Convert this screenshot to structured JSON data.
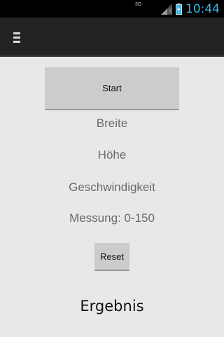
{
  "status_bar": {
    "network_type": "3G",
    "time": "10:44",
    "icons": [
      "signal-icon",
      "battery-charging-icon"
    ]
  },
  "action_bar": {
    "menu_icon": "menu-icon"
  },
  "main": {
    "start_label": "Start",
    "width_label": "Breite",
    "height_label": "Höhe",
    "speed_label": "Geschwindigkeit",
    "measurement_label": "Messung: 0-150",
    "reset_label": "Reset",
    "result_label": "Ergebnis"
  },
  "colors": {
    "status_bar_bg": "#000000",
    "clock": "#33b5e5",
    "action_bar_bg": "#222222",
    "screen_bg": "#e8e8e8",
    "button_bg": "#cccccc",
    "label_text": "#6b6b6b"
  }
}
